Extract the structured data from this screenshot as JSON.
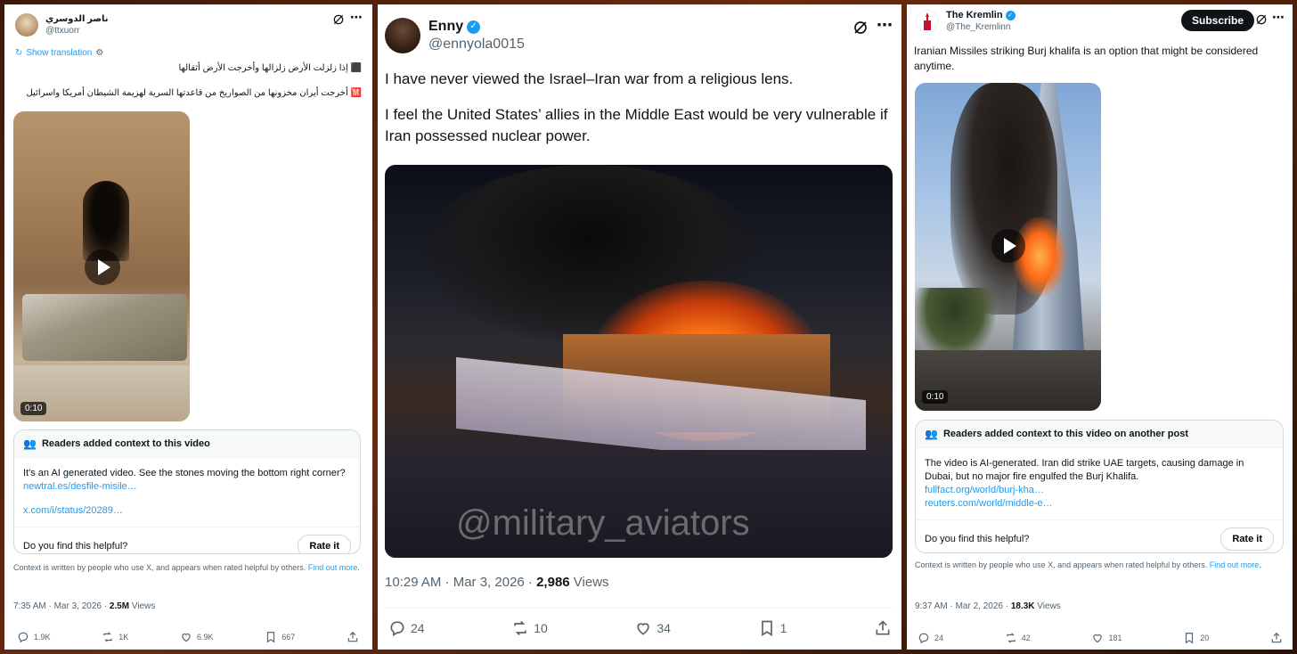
{
  "post1": {
    "author_name": "ناصر الدوسري",
    "handle": "@ttxuorr",
    "show_translation": "Show translation",
    "line1": "⬛ إذا زلزلت الأرض زلزالها وأخرجت الأرض أثقالها",
    "line2": "🈲 أخرجت أيران مخزونها من الصواريخ من قاعدتها السرية لهزيمة الشيطان أمريكا واسرائيل",
    "video_duration": "0:10",
    "note_header": "Readers added context to this video",
    "note_text": "It's an AI generated video. See the stones moving the bottom right corner?",
    "note_link1": "newtral.es/desfile-misile…",
    "note_link2": "x.com/i/status/20289…",
    "note_question": "Do you find this helpful?",
    "rate_label": "Rate it",
    "context_text": "Context is written by people who use X, and appears when rated helpful by others.",
    "find_out_more": "Find out more",
    "timestamp": "7:35 AM · Mar 3, 2026 · ",
    "views_count": "2.5M",
    "views_label": " Views",
    "replies": "1.9K",
    "reposts": "1K",
    "likes": "6.9K",
    "bookmarks": "667"
  },
  "post2": {
    "author_name": "Enny",
    "handle": "@ennyola0015",
    "text1": "I have never viewed the Israel–Iran war from a religious lens.",
    "text2": "I feel the United States’ allies in the Middle East would be very vulnerable if Iran possessed nuclear power.",
    "watermark": "@military_aviators",
    "timestamp": "10:29 AM · Mar 3, 2026 · ",
    "views_count": "2,986",
    "views_label": " Views",
    "replies": "24",
    "reposts": "10",
    "likes": "34",
    "bookmarks": "1"
  },
  "post3": {
    "author_name": "The Kremlin",
    "handle": "@The_Kremlinn",
    "subscribe_label": "Subscribe",
    "text": "Iranian Missiles striking Burj khalifa is an option that might be considered anytime.",
    "video_duration": "0:10",
    "note_header": "Readers added context to this video on another post",
    "note_text": "The video is AI-generated. Iran did strike UAE targets, causing damage in Dubai, but no major fire engulfed the Burj Khalifa.",
    "note_link1": "fullfact.org/world/burj-kha…",
    "note_link2": "reuters.com/world/middle-e…",
    "note_question": "Do you find this helpful?",
    "rate_label": "Rate it",
    "context_text": "Context is written by people who use X, and appears when rated helpful by others.",
    "find_out_more": "Find out more",
    "timestamp": "9:37 AM · Mar 2, 2026 · ",
    "views_count": "18.3K",
    "views_label": " Views",
    "replies": "24",
    "reposts": "42",
    "likes": "181",
    "bookmarks": "20"
  },
  "colors": {
    "accent": "#1d9bf0",
    "text": "#0f1419",
    "muted": "#536471"
  }
}
